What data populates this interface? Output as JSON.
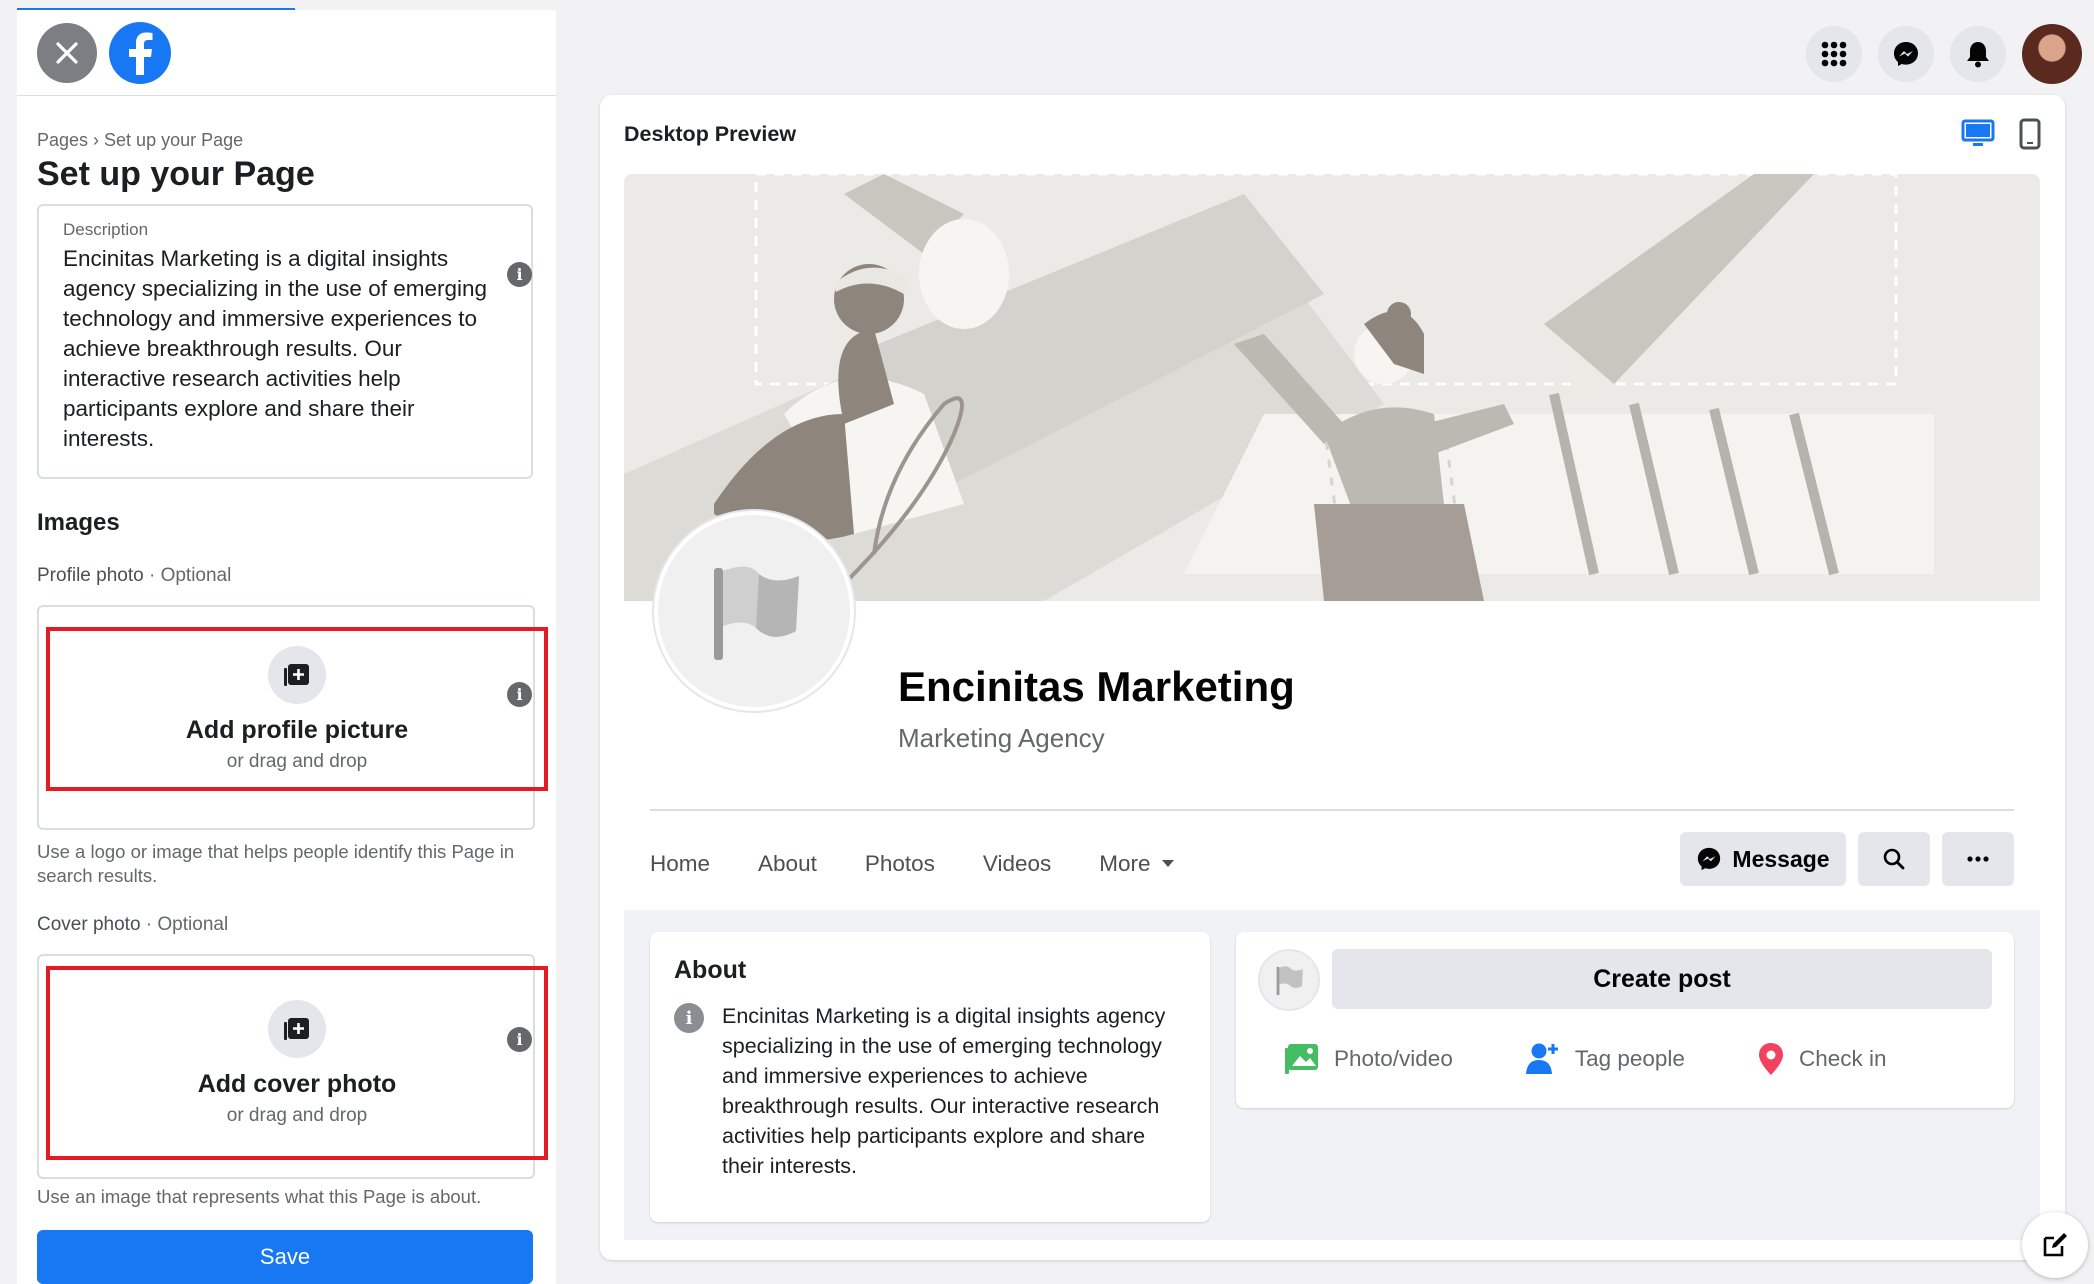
{
  "left_panel": {
    "breadcrumb": "Pages › Set up your Page",
    "title": "Set up your Page",
    "description": {
      "label": "Description",
      "value": "Encinitas Marketing is a digital insights agency specializing in the use of emerging technology and immersive experiences to achieve breakthrough results. Our interactive research activities help participants explore and share their interests."
    },
    "images_heading": "Images",
    "profile_photo": {
      "label": "Profile photo",
      "optional": "· Optional",
      "upload_title": "Add profile picture",
      "upload_sub": "or drag and drop",
      "help": "Use a logo or image that helps people identify this Page in search results."
    },
    "cover_photo": {
      "label": "Cover photo",
      "optional": "· Optional",
      "upload_title": "Add cover photo",
      "upload_sub": "or drag and drop",
      "help": "Use an image that represents what this Page is about."
    },
    "save_label": "Save"
  },
  "top_icons": [
    "menu-grid-icon",
    "messenger-icon",
    "notifications-bell-icon",
    "account-avatar"
  ],
  "preview": {
    "title": "Desktop Preview",
    "page_name": "Encinitas Marketing",
    "category": "Marketing Agency",
    "tabs": [
      "Home",
      "About",
      "Photos",
      "Videos",
      "More"
    ],
    "message_label": "Message",
    "about": {
      "title": "About",
      "text": "Encinitas Marketing is a digital insights agency specializing in the use of emerging technology and immersive experiences to achieve breakthrough results. Our interactive research activities help participants explore and share their interests."
    },
    "create_post_label": "Create post",
    "post_options": [
      "Photo/video",
      "Tag people",
      "Check in"
    ]
  },
  "colors": {
    "brand_blue": "#1877f2",
    "highlight_red": "#e31b23",
    "photo_green": "#45bd62",
    "checkin_red": "#f3425f"
  }
}
